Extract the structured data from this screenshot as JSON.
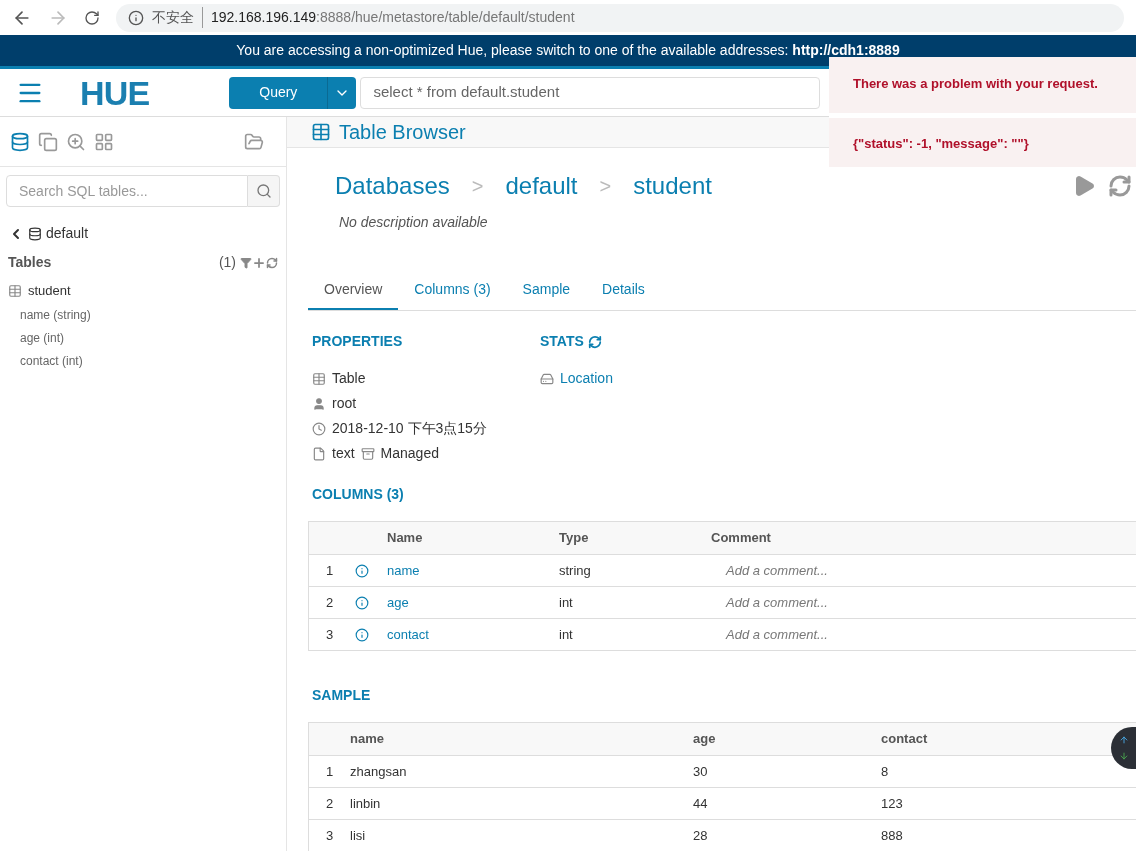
{
  "browser": {
    "security": "不安全",
    "url_host": "192.168.196.149",
    "url_path": ":8888/hue/metastore/table/default/student"
  },
  "banner": {
    "text": "You are accessing a non-optimized Hue, please switch to one of the available addresses:",
    "link": "http://cdh1:8889"
  },
  "header": {
    "logo": "HUE",
    "query_button": "Query",
    "editor_value": "select * from default.student"
  },
  "toast": {
    "title": "There was a problem with your request.",
    "message": "{\"status\": -1, \"message\": \"\"}"
  },
  "sidebar": {
    "search_placeholder": "Search SQL tables...",
    "database": "default",
    "tables_label": "Tables",
    "tables_count": "(1)",
    "tables": [
      {
        "name": "student",
        "children": [
          {
            "name": "name (string)"
          },
          {
            "name": "age (int)"
          },
          {
            "name": "contact (int)"
          }
        ]
      }
    ]
  },
  "main": {
    "title": "Table Browser",
    "breadcrumbs": [
      "Databases",
      "default",
      "student"
    ],
    "separator": ">",
    "description": "No description available",
    "tabs": [
      {
        "label": "Overview",
        "selected": true
      },
      {
        "label": "Columns (3)",
        "selected": false
      },
      {
        "label": "Sample",
        "selected": false
      },
      {
        "label": "Details",
        "selected": false
      }
    ],
    "properties": {
      "heading": "PROPERTIES",
      "type": "Table",
      "owner": "root",
      "created": "2018-12-10 下午3点15分",
      "format": "text",
      "managed": "Managed"
    },
    "stats": {
      "heading": "STATS",
      "location": "Location"
    },
    "columns": {
      "heading": "COLUMNS (3)",
      "headers": [
        "Name",
        "Type",
        "Comment"
      ],
      "rows": [
        {
          "index": "1",
          "name": "name",
          "type": "string",
          "comment": "Add a comment..."
        },
        {
          "index": "2",
          "name": "age",
          "type": "int",
          "comment": "Add a comment..."
        },
        {
          "index": "3",
          "name": "contact",
          "type": "int",
          "comment": "Add a comment..."
        }
      ]
    },
    "sample": {
      "heading": "SAMPLE",
      "headers": [
        "name",
        "age",
        "contact"
      ],
      "rows": [
        [
          "1",
          "zhangsan",
          "30",
          "8"
        ],
        [
          "2",
          "linbin",
          "44",
          "123"
        ],
        [
          "3",
          "lisi",
          "28",
          "888"
        ]
      ]
    }
  }
}
